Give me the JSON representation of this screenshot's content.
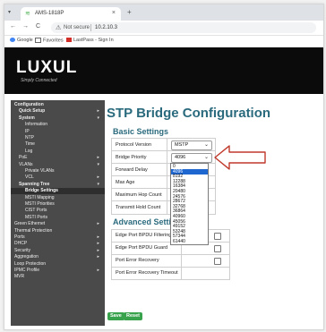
{
  "browser": {
    "tab_title": "AMS-1818P",
    "tab_close": "×",
    "new_tab": "+",
    "menu_icon": "▾",
    "nav": {
      "back": "←",
      "forward": "→",
      "reload": "C"
    },
    "security_label": "Not secure",
    "url": "10.2.10.3",
    "bookmarks": [
      "Google",
      "Favorites",
      "LastPass - Sign In"
    ]
  },
  "brand": {
    "logo": "LUXUL",
    "tagline": "Simply Connected"
  },
  "sidebar": {
    "items": [
      {
        "label": "Configuration",
        "indent": 0,
        "arrow": "",
        "active": false,
        "header": true
      },
      {
        "label": "Quick Setup",
        "indent": 1,
        "arrow": "▸",
        "active": false,
        "header": true
      },
      {
        "label": "System",
        "indent": 1,
        "arrow": "▾",
        "active": false,
        "header": true
      },
      {
        "label": "Information",
        "indent": 2,
        "arrow": "",
        "active": false
      },
      {
        "label": "IP",
        "indent": 2,
        "arrow": "",
        "active": false
      },
      {
        "label": "NTP",
        "indent": 2,
        "arrow": "",
        "active": false
      },
      {
        "label": "Time",
        "indent": 2,
        "arrow": "",
        "active": false
      },
      {
        "label": "Log",
        "indent": 2,
        "arrow": "",
        "active": false
      },
      {
        "label": "PoE",
        "indent": 1,
        "arrow": "▸",
        "active": false
      },
      {
        "label": "VLANs",
        "indent": 1,
        "arrow": "▾",
        "active": false
      },
      {
        "label": "Private VLANs",
        "indent": 2,
        "arrow": "",
        "active": false
      },
      {
        "label": "VCL",
        "indent": 2,
        "arrow": "▸",
        "active": false
      },
      {
        "label": "Spanning Tree",
        "indent": 1,
        "arrow": "▾",
        "active": false,
        "header": true
      },
      {
        "label": "Bridge Settings",
        "indent": 2,
        "arrow": "",
        "active": true
      },
      {
        "label": "MSTI Mapping",
        "indent": 2,
        "arrow": "",
        "active": false
      },
      {
        "label": "MSTI Priorities",
        "indent": 2,
        "arrow": "",
        "active": false
      },
      {
        "label": "CIST Ports",
        "indent": 2,
        "arrow": "",
        "active": false
      },
      {
        "label": "MSTI Ports",
        "indent": 2,
        "arrow": "",
        "active": false
      },
      {
        "label": "Green Ethernet",
        "indent": 0,
        "arrow": "▸",
        "active": false
      },
      {
        "label": "Thermal Protection",
        "indent": 0,
        "arrow": "",
        "active": false
      },
      {
        "label": "Ports",
        "indent": 0,
        "arrow": "▸",
        "active": false
      },
      {
        "label": "DHCP",
        "indent": 0,
        "arrow": "▸",
        "active": false
      },
      {
        "label": "Security",
        "indent": 0,
        "arrow": "▸",
        "active": false
      },
      {
        "label": "Aggregation",
        "indent": 0,
        "arrow": "▸",
        "active": false
      },
      {
        "label": "Loop Protection",
        "indent": 0,
        "arrow": "",
        "active": false
      },
      {
        "label": "IPMC Profile",
        "indent": 0,
        "arrow": "▸",
        "active": false
      },
      {
        "label": "MVR",
        "indent": 0,
        "arrow": "",
        "active": false
      }
    ]
  },
  "main": {
    "title": "STP Bridge Configuration",
    "basic_title": "Basic Settings",
    "basic_rows": [
      {
        "label": "Protocol Version",
        "value": "MSTP",
        "chevron": "⌄"
      },
      {
        "label": "Bridge Priority",
        "value": "4096",
        "chevron": "⌄"
      },
      {
        "label": "Forward Delay",
        "value": ""
      },
      {
        "label": "Max Age",
        "value": ""
      },
      {
        "label": "Maximum Hop Count",
        "value": ""
      },
      {
        "label": "Transmit Hold Count",
        "value": ""
      }
    ],
    "advanced_title": "Advanced Settings",
    "advanced_rows": [
      {
        "label": "Edge Port BPDU Filtering"
      },
      {
        "label": "Edge Port BPDU Guard"
      },
      {
        "label": "Port Error Recovery"
      },
      {
        "label": "Port Error Recovery Timeout"
      }
    ],
    "priority_options": [
      "0",
      "4096",
      "8192",
      "12288",
      "16384",
      "20480",
      "24576",
      "28672",
      "32768",
      "36864",
      "40960",
      "45056",
      "49152",
      "53248",
      "57344",
      "61440"
    ],
    "priority_selected": "4096",
    "buttons": {
      "save": "Save",
      "reset": "Reset"
    }
  },
  "colors": {
    "accent": "#2a6a7d",
    "sidebar_bg": "#4a4a4a",
    "button": "#38a34c",
    "annotation_arrow": "#c0392b"
  }
}
